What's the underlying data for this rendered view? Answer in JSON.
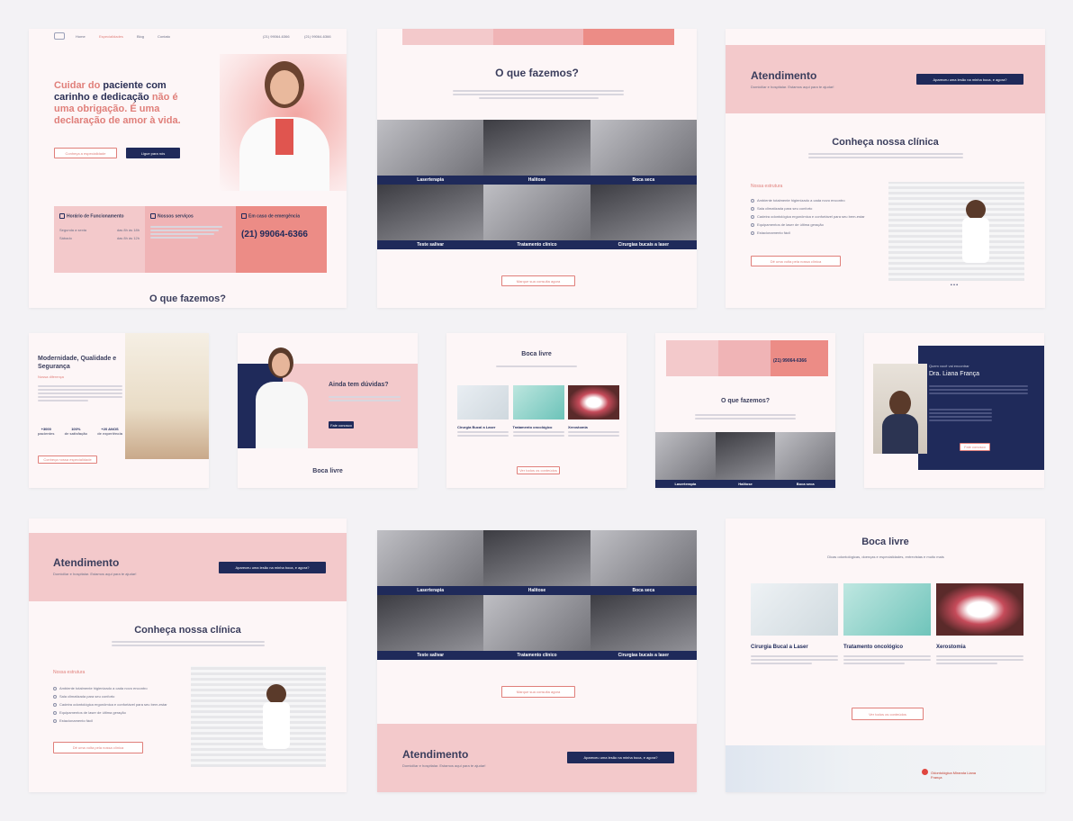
{
  "hero": {
    "nav": [
      "Home",
      "Especialidades",
      "Blog",
      "Contato"
    ],
    "phone1": "(21) 99064-6366",
    "phone2": "(21) 99064-6366",
    "headline_a": "Cuidar do ",
    "headline_b": "paciente com carinho e dedicação ",
    "headline_c": "não é uma obrigação",
    "headline_d": ". É uma declaração de amor à vida.",
    "btn1": "Conheça a especialidade",
    "btn2": "Ligue para nós"
  },
  "info": {
    "hours_title": "Horário de Funcionamento",
    "hours": [
      [
        "Segunda a sexta",
        "das 8h às 18h"
      ],
      [
        "Sábado",
        "das 8h às 12h"
      ]
    ],
    "services_title": "Nossos serviços",
    "emergency_title": "Em caso de emergência",
    "emergency_phone": "(21) 99064-6366",
    "what_we_do": "O que fazemos?"
  },
  "services": {
    "title": "O que fazemos?",
    "tiles": [
      "Laserterapia",
      "Halitose",
      "Boca seca",
      "Teste salivar",
      "Tratamento clínico",
      "Cirurgias bucais a laser"
    ],
    "button": "Marque sua consulta agora"
  },
  "atendimento": {
    "title": "Atendimento",
    "subtitle": "Domiciliar e hospitalar. Estamos aqui para te ajudar!",
    "button": "Apareceu uma lesão na minha boca, e agora?"
  },
  "clinic": {
    "title": "Conheça nossa clínica",
    "structure_title": "Nossa estrutura",
    "items": [
      "Ambiente totalmente higienizado a cada novo encontro",
      "Sala climatizada para seu conforto",
      "Cadeira odontológica ergonômica e confortável para seu bem-estar",
      "Equipamentos de laser de última geração",
      "Estacionamento fácil"
    ],
    "button": "Dê uma volta pela nossa clínica"
  },
  "modern": {
    "title": "Modernidade, Qualidade e Segurança",
    "sub": "Nossa diferença",
    "stats": [
      [
        "+3000",
        "pacientes"
      ],
      [
        "100%",
        "de satisfação"
      ],
      [
        "+20 ANOS",
        "de experiência"
      ]
    ],
    "button": "Conheça nossa especialidade"
  },
  "doubts": {
    "title": "Ainda tem dúvidas?",
    "button": "Fale conosco",
    "section": "Boca livre"
  },
  "blog": {
    "title": "Boca livre",
    "posts": [
      "Cirurgia Bucal a Laser",
      "Tratamento oncológico",
      "Xerostomia"
    ],
    "button": "Ver todos os conteúdos"
  },
  "about": {
    "kicker": "Quem você vai encontrar",
    "name": "Dra. Liana França",
    "button": "Fale conosco"
  },
  "blog2": {
    "title": "Boca livre",
    "subtitle": "Dicas odontológicas, doenças e especialidades, entrevistas e muito mais",
    "posts": [
      "Cirurgia Bucal a Laser",
      "Tratamento oncológico",
      "Xerostomia"
    ],
    "button": "Ver todos os conteúdos",
    "map_label": "Odontológica Miranda Liana França"
  },
  "colors": {
    "navy": "#1f2a5a",
    "coral": "#e07f7a",
    "pink": "#f3c9cb"
  }
}
